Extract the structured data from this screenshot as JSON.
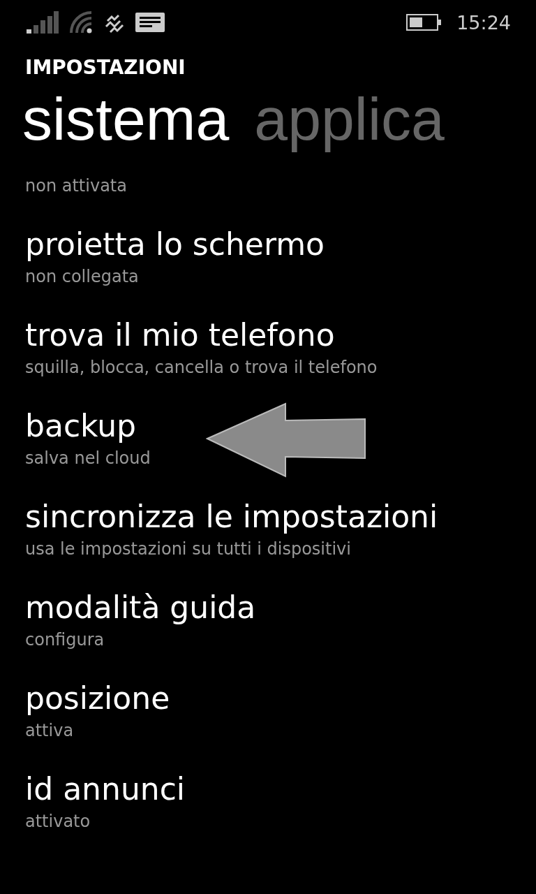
{
  "status_bar": {
    "time": "15:24"
  },
  "header": {
    "title": "IMPOSTAZIONI"
  },
  "pivots": [
    {
      "label": "sistema",
      "selected": true
    },
    {
      "label": "applica",
      "selected": false
    }
  ],
  "items": [
    {
      "subtitle": "non attivata",
      "arrow": false
    },
    {
      "title": "proietta lo schermo",
      "subtitle": "non collegata",
      "arrow": false
    },
    {
      "title": "trova il mio telefono",
      "subtitle": "squilla, blocca, cancella o trova il telefono",
      "arrow": false
    },
    {
      "title": "backup",
      "subtitle": "salva nel cloud",
      "arrow": true
    },
    {
      "title": "sincronizza le impostazioni",
      "subtitle": "usa le impostazioni su tutti i dispositivi",
      "arrow": false
    },
    {
      "title": "modalità guida",
      "subtitle": "configura",
      "arrow": false
    },
    {
      "title": "posizione",
      "subtitle": "attiva",
      "arrow": false
    },
    {
      "title": "id annunci",
      "subtitle": "attivato",
      "arrow": false
    }
  ]
}
